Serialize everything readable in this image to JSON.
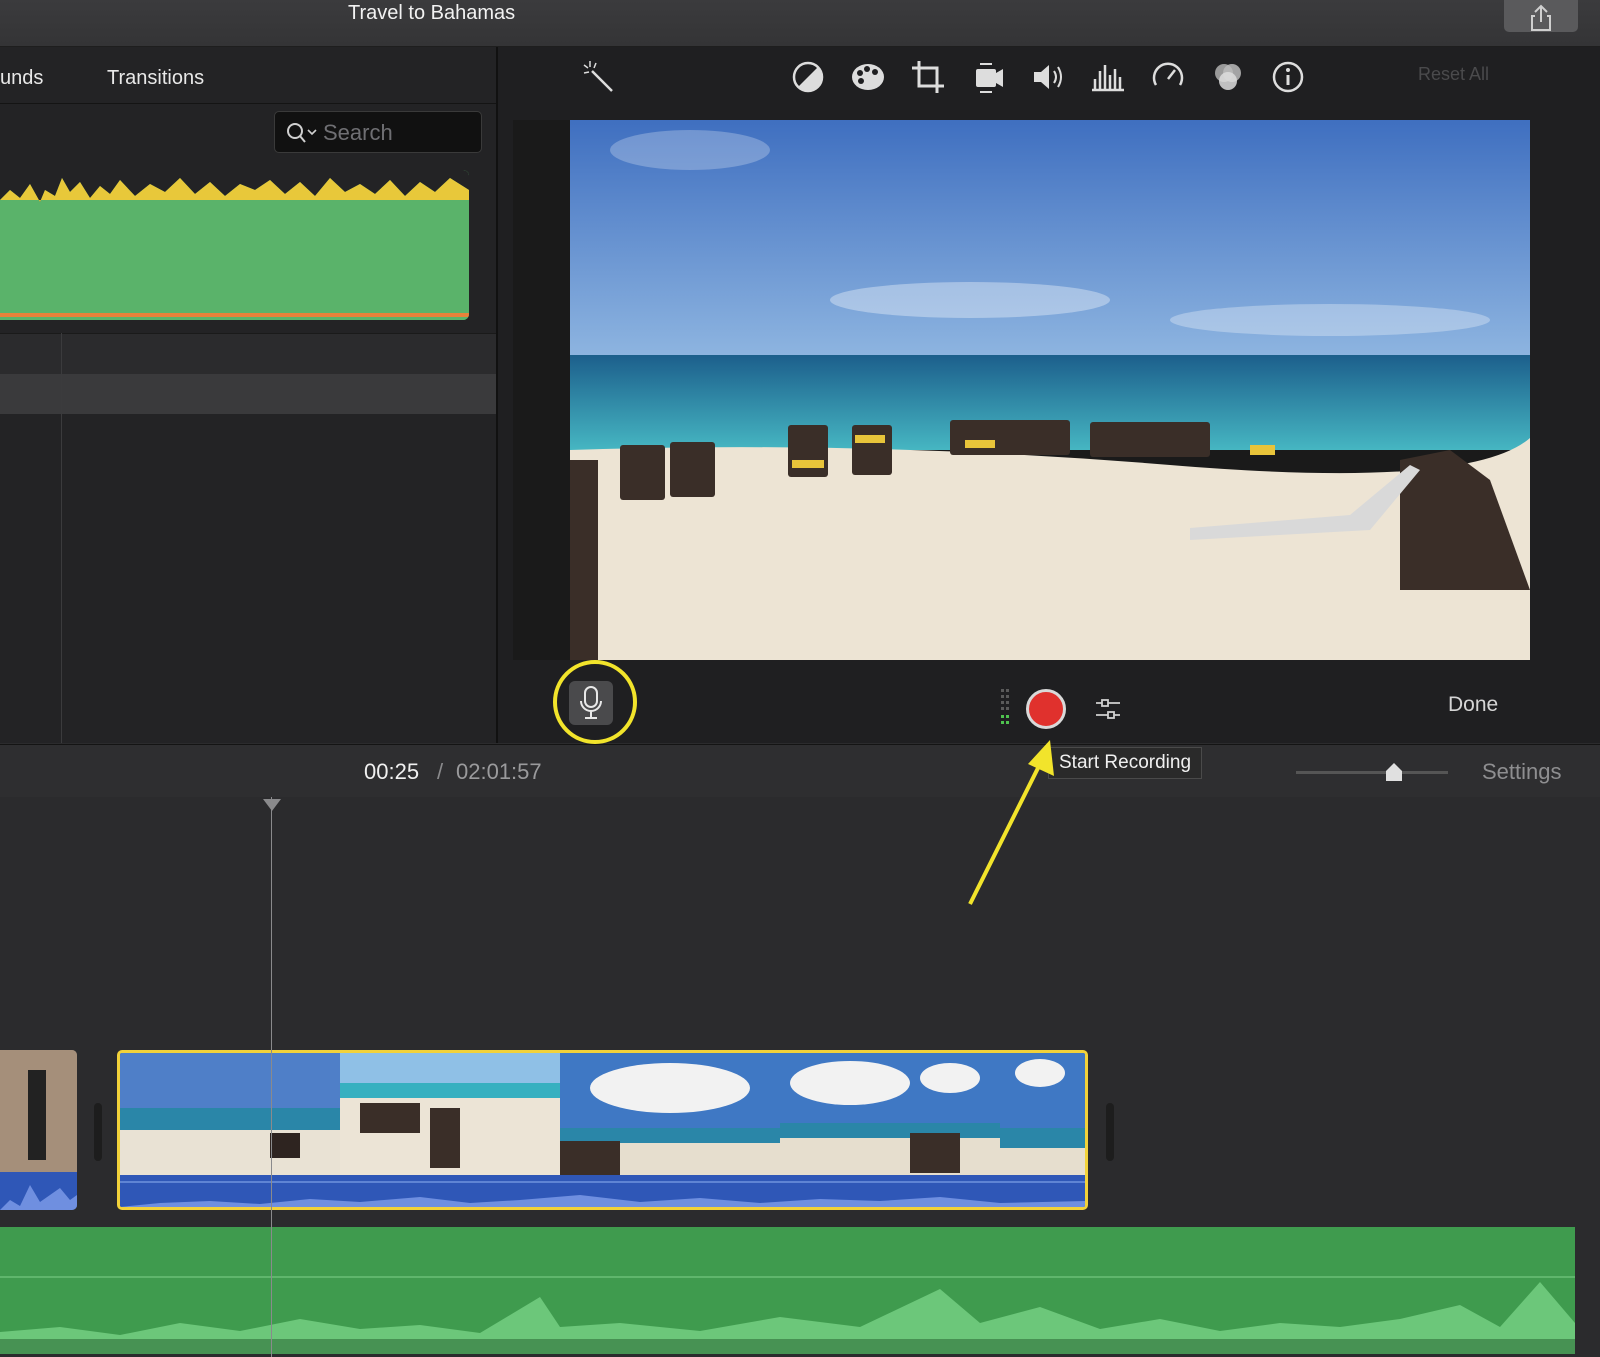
{
  "window": {
    "title": "Travel to Bahamas"
  },
  "browser": {
    "tabs": [
      "unds",
      "Transitions"
    ],
    "search_placeholder": "Search"
  },
  "viewer": {
    "reset_label": "Reset All",
    "done_label": "Done",
    "tools": [
      "magic-wand-icon",
      "color-balance-icon",
      "color-palette-icon",
      "crop-icon",
      "stabilization-icon",
      "volume-icon",
      "equalizer-icon",
      "speed-icon",
      "clip-filter-icon",
      "info-icon"
    ]
  },
  "recording": {
    "tooltip": "Start Recording",
    "record_color": "#e0312d"
  },
  "timeline": {
    "current_time": "00:25",
    "separator": "/",
    "total_time": "02:01:57",
    "settings_label": "Settings"
  },
  "colors": {
    "selection": "#f2d23a",
    "annotation": "#f2e42b",
    "audio_clip": "#2f57b7",
    "music_track": "#3f9b4e"
  }
}
